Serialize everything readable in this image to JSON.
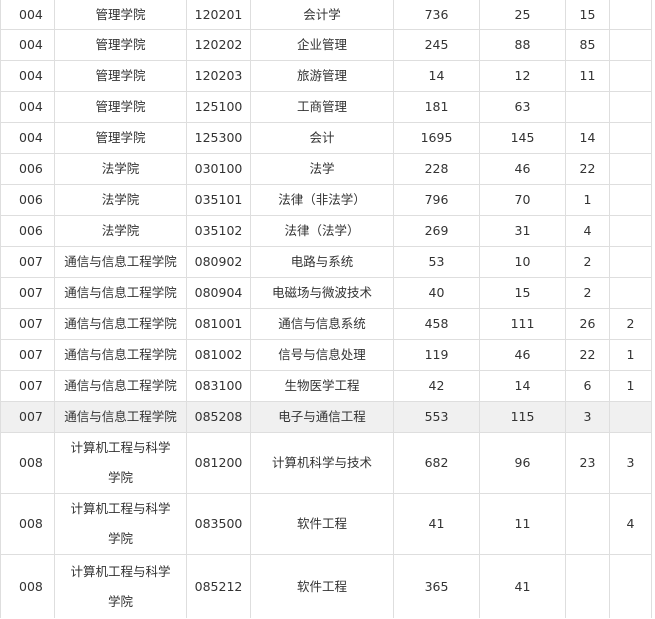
{
  "table": {
    "rows": [
      {
        "dept_code": "004",
        "college": "管理学院",
        "major_code": "120201",
        "major": "会计学",
        "a": "736",
        "b": "25",
        "c": "15",
        "d": ""
      },
      {
        "dept_code": "004",
        "college": "管理学院",
        "major_code": "120202",
        "major": "企业管理",
        "a": "245",
        "b": "88",
        "c": "85",
        "d": ""
      },
      {
        "dept_code": "004",
        "college": "管理学院",
        "major_code": "120203",
        "major": "旅游管理",
        "a": "14",
        "b": "12",
        "c": "11",
        "d": ""
      },
      {
        "dept_code": "004",
        "college": "管理学院",
        "major_code": "125100",
        "major": "工商管理",
        "a": "181",
        "b": "63",
        "c": "",
        "d": ""
      },
      {
        "dept_code": "004",
        "college": "管理学院",
        "major_code": "125300",
        "major": "会计",
        "a": "1695",
        "b": "145",
        "c": "14",
        "d": ""
      },
      {
        "dept_code": "006",
        "college": "法学院",
        "major_code": "030100",
        "major": "法学",
        "a": "228",
        "b": "46",
        "c": "22",
        "d": ""
      },
      {
        "dept_code": "006",
        "college": "法学院",
        "major_code": "035101",
        "major": "法律（非法学）",
        "a": "796",
        "b": "70",
        "c": "1",
        "d": ""
      },
      {
        "dept_code": "006",
        "college": "法学院",
        "major_code": "035102",
        "major": "法律（法学）",
        "a": "269",
        "b": "31",
        "c": "4",
        "d": ""
      },
      {
        "dept_code": "007",
        "college": "通信与信息工程学院",
        "major_code": "080902",
        "major": "电路与系统",
        "a": "53",
        "b": "10",
        "c": "2",
        "d": ""
      },
      {
        "dept_code": "007",
        "college": "通信与信息工程学院",
        "major_code": "080904",
        "major": "电磁场与微波技术",
        "a": "40",
        "b": "15",
        "c": "2",
        "d": ""
      },
      {
        "dept_code": "007",
        "college": "通信与信息工程学院",
        "major_code": "081001",
        "major": "通信与信息系统",
        "a": "458",
        "b": "111",
        "c": "26",
        "d": "2"
      },
      {
        "dept_code": "007",
        "college": "通信与信息工程学院",
        "major_code": "081002",
        "major": "信号与信息处理",
        "a": "119",
        "b": "46",
        "c": "22",
        "d": "1"
      },
      {
        "dept_code": "007",
        "college": "通信与信息工程学院",
        "major_code": "083100",
        "major": "生物医学工程",
        "a": "42",
        "b": "14",
        "c": "6",
        "d": "1"
      },
      {
        "dept_code": "007",
        "college": "通信与信息工程学院",
        "major_code": "085208",
        "major": "电子与通信工程",
        "a": "553",
        "b": "115",
        "c": "3",
        "d": ""
      },
      {
        "dept_code": "008",
        "college": "计算机工程与科学学院",
        "major_code": "081200",
        "major": "计算机科学与技术",
        "a": "682",
        "b": "96",
        "c": "23",
        "d": "3"
      },
      {
        "dept_code": "008",
        "college": "计算机工程与科学学院",
        "major_code": "083500",
        "major": "软件工程",
        "a": "41",
        "b": "11",
        "c": "",
        "d": "4"
      },
      {
        "dept_code": "008",
        "college": "计算机工程与科学学院",
        "major_code": "085212",
        "major": "软件工程",
        "a": "365",
        "b": "41",
        "c": "",
        "d": ""
      }
    ]
  }
}
